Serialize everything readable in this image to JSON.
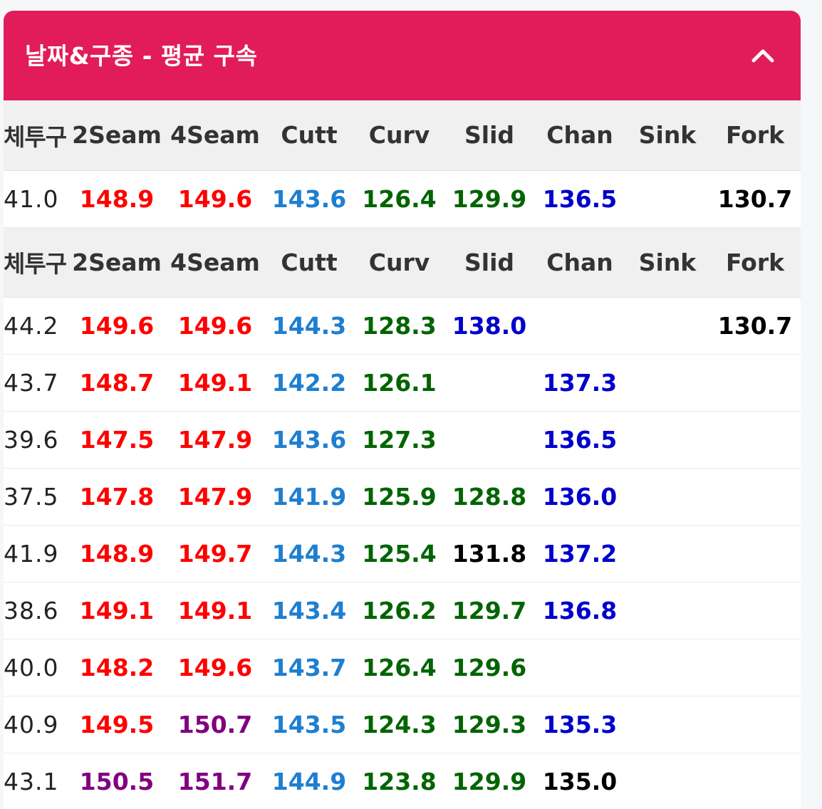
{
  "card": {
    "title": "날짜&구종 - 평균 구속"
  },
  "colors": {
    "header_bg": "#e21c5b",
    "fast": "#ff0000",
    "fastest": "#800080",
    "cutter": "#1e7fd0",
    "breaking": "#006400",
    "offspeed": "#0000cc",
    "neutral": "#000000"
  },
  "icons": {
    "collapse": "chevron-up-icon"
  },
  "tables": [
    {
      "columns": [
        "체투구",
        "2Seam",
        "4Seam",
        "Cutt",
        "Curv",
        "Slid",
        "Chan",
        "Sink",
        "Fork"
      ],
      "rows": [
        {
          "cells": [
            {
              "v": "41.0",
              "c": "c-black"
            },
            {
              "v": "148.9",
              "c": "c-red"
            },
            {
              "v": "149.6",
              "c": "c-red"
            },
            {
              "v": "143.6",
              "c": "c-blue"
            },
            {
              "v": "126.4",
              "c": "c-green"
            },
            {
              "v": "129.9",
              "c": "c-green"
            },
            {
              "v": "136.5",
              "c": "c-navy"
            },
            {
              "v": "",
              "c": "c-black"
            },
            {
              "v": "130.7",
              "c": "c-black"
            }
          ]
        }
      ]
    },
    {
      "columns": [
        "체투구",
        "2Seam",
        "4Seam",
        "Cutt",
        "Curv",
        "Slid",
        "Chan",
        "Sink",
        "Fork"
      ],
      "rows": [
        {
          "cells": [
            {
              "v": "44.2",
              "c": "c-black"
            },
            {
              "v": "149.6",
              "c": "c-red"
            },
            {
              "v": "149.6",
              "c": "c-red"
            },
            {
              "v": "144.3",
              "c": "c-blue"
            },
            {
              "v": "128.3",
              "c": "c-green"
            },
            {
              "v": "138.0",
              "c": "c-navy"
            },
            {
              "v": "",
              "c": "c-black"
            },
            {
              "v": "",
              "c": "c-black"
            },
            {
              "v": "130.7",
              "c": "c-black"
            }
          ]
        },
        {
          "cells": [
            {
              "v": "43.7",
              "c": "c-black"
            },
            {
              "v": "148.7",
              "c": "c-red"
            },
            {
              "v": "149.1",
              "c": "c-red"
            },
            {
              "v": "142.2",
              "c": "c-blue"
            },
            {
              "v": "126.1",
              "c": "c-green"
            },
            {
              "v": "",
              "c": "c-black"
            },
            {
              "v": "137.3",
              "c": "c-navy"
            },
            {
              "v": "",
              "c": "c-black"
            },
            {
              "v": "",
              "c": "c-black"
            }
          ]
        },
        {
          "cells": [
            {
              "v": "39.6",
              "c": "c-black"
            },
            {
              "v": "147.5",
              "c": "c-red"
            },
            {
              "v": "147.9",
              "c": "c-red"
            },
            {
              "v": "143.6",
              "c": "c-blue"
            },
            {
              "v": "127.3",
              "c": "c-green"
            },
            {
              "v": "",
              "c": "c-black"
            },
            {
              "v": "136.5",
              "c": "c-navy"
            },
            {
              "v": "",
              "c": "c-black"
            },
            {
              "v": "",
              "c": "c-black"
            }
          ]
        },
        {
          "cells": [
            {
              "v": "37.5",
              "c": "c-black"
            },
            {
              "v": "147.8",
              "c": "c-red"
            },
            {
              "v": "147.9",
              "c": "c-red"
            },
            {
              "v": "141.9",
              "c": "c-blue"
            },
            {
              "v": "125.9",
              "c": "c-green"
            },
            {
              "v": "128.8",
              "c": "c-green"
            },
            {
              "v": "136.0",
              "c": "c-navy"
            },
            {
              "v": "",
              "c": "c-black"
            },
            {
              "v": "",
              "c": "c-black"
            }
          ]
        },
        {
          "cells": [
            {
              "v": "41.9",
              "c": "c-black"
            },
            {
              "v": "148.9",
              "c": "c-red"
            },
            {
              "v": "149.7",
              "c": "c-red"
            },
            {
              "v": "144.3",
              "c": "c-blue"
            },
            {
              "v": "125.4",
              "c": "c-green"
            },
            {
              "v": "131.8",
              "c": "c-black"
            },
            {
              "v": "137.2",
              "c": "c-navy"
            },
            {
              "v": "",
              "c": "c-black"
            },
            {
              "v": "",
              "c": "c-black"
            }
          ]
        },
        {
          "cells": [
            {
              "v": "38.6",
              "c": "c-black"
            },
            {
              "v": "149.1",
              "c": "c-red"
            },
            {
              "v": "149.1",
              "c": "c-red"
            },
            {
              "v": "143.4",
              "c": "c-blue"
            },
            {
              "v": "126.2",
              "c": "c-green"
            },
            {
              "v": "129.7",
              "c": "c-green"
            },
            {
              "v": "136.8",
              "c": "c-navy"
            },
            {
              "v": "",
              "c": "c-black"
            },
            {
              "v": "",
              "c": "c-black"
            }
          ]
        },
        {
          "cells": [
            {
              "v": "40.0",
              "c": "c-black"
            },
            {
              "v": "148.2",
              "c": "c-red"
            },
            {
              "v": "149.6",
              "c": "c-red"
            },
            {
              "v": "143.7",
              "c": "c-blue"
            },
            {
              "v": "126.4",
              "c": "c-green"
            },
            {
              "v": "129.6",
              "c": "c-green"
            },
            {
              "v": "",
              "c": "c-black"
            },
            {
              "v": "",
              "c": "c-black"
            },
            {
              "v": "",
              "c": "c-black"
            }
          ]
        },
        {
          "cells": [
            {
              "v": "40.9",
              "c": "c-black"
            },
            {
              "v": "149.5",
              "c": "c-red"
            },
            {
              "v": "150.7",
              "c": "c-purple"
            },
            {
              "v": "143.5",
              "c": "c-blue"
            },
            {
              "v": "124.3",
              "c": "c-green"
            },
            {
              "v": "129.3",
              "c": "c-green"
            },
            {
              "v": "135.3",
              "c": "c-navy"
            },
            {
              "v": "",
              "c": "c-black"
            },
            {
              "v": "",
              "c": "c-black"
            }
          ]
        },
        {
          "cells": [
            {
              "v": "43.1",
              "c": "c-black"
            },
            {
              "v": "150.5",
              "c": "c-purple"
            },
            {
              "v": "151.7",
              "c": "c-purple"
            },
            {
              "v": "144.9",
              "c": "c-blue"
            },
            {
              "v": "123.8",
              "c": "c-green"
            },
            {
              "v": "129.9",
              "c": "c-green"
            },
            {
              "v": "135.0",
              "c": "c-black"
            },
            {
              "v": "",
              "c": "c-black"
            },
            {
              "v": "",
              "c": "c-black"
            }
          ]
        }
      ]
    }
  ]
}
